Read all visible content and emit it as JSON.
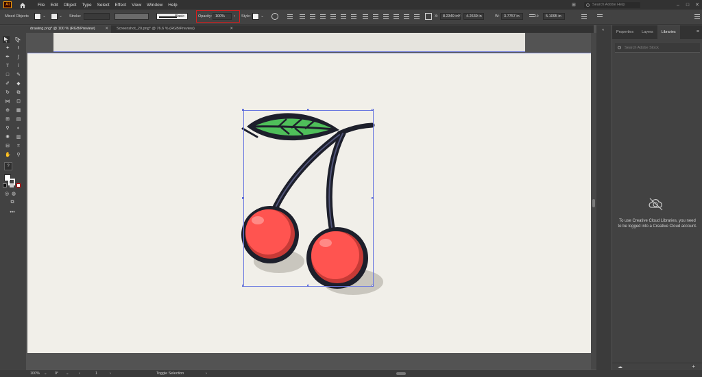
{
  "app": {
    "logo": "Ai"
  },
  "menu": [
    "File",
    "Edit",
    "Object",
    "Type",
    "Select",
    "Effect",
    "View",
    "Window",
    "Help"
  ],
  "search": {
    "placeholder": "Search Adobe Help"
  },
  "control_bar": {
    "selection_label": "Mixed Objects",
    "stroke_label": "Stroke:",
    "brush_style": "Basic",
    "opacity_label": "Opacity:",
    "opacity_value": "100%",
    "style_label": "Style:",
    "x_label": "X:",
    "x_value": "8.2349 in",
    "y_label": "Y:",
    "y_value": "4.2639 in",
    "w_label": "W:",
    "w_value": "3.7757 in",
    "h_label": "H:",
    "h_value": "5.1095 in"
  },
  "documents": [
    {
      "label": "drawing.png* @ 100 % (RGB/Preview)"
    },
    {
      "label": "Screenshot_20.png* @ 76.6 % (RGB/Preview)"
    }
  ],
  "panel": {
    "tabs": [
      "Properties",
      "Layers",
      "Libraries"
    ],
    "active_tab": "Libraries",
    "search_placeholder": "Search Adobe Stock",
    "message": "To use Creative Cloud Libraries, you need to be logged into a Creative Cloud account."
  },
  "status": {
    "zoom": "100%",
    "rotation": "0°",
    "artboard": "1",
    "tool_hint": "Toggle Selection"
  },
  "colors": {
    "highlight": "#d81e1e",
    "selection": "#6a78e0",
    "cherry": "#ff5450",
    "leaf": "#4fbf5a"
  }
}
